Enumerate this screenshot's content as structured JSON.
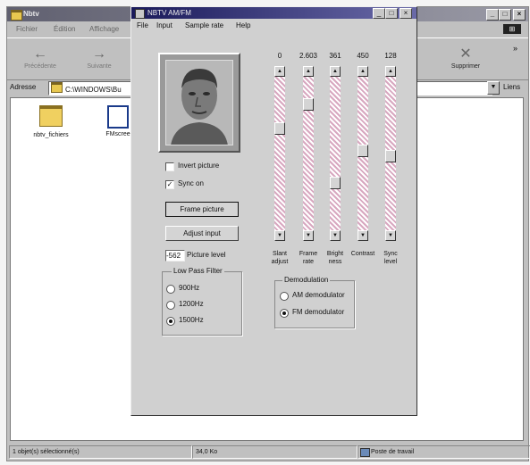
{
  "explorer": {
    "title": "Nbtv",
    "menu": [
      "Fichier",
      "Édition",
      "Affichage"
    ],
    "toolbar": {
      "back": "Précédente",
      "forward": "Suivante",
      "delete": "Supprimer"
    },
    "address_label": "Adresse",
    "address_value": "C:\\WINDOWS\\Bu",
    "links_label": "Liens",
    "files": [
      {
        "name": "nbtv_fichiers",
        "icon": "folder-icon"
      },
      {
        "name": "FMscree",
        "icon": "document-icon"
      }
    ],
    "status": {
      "selection": "1 objet(s) sélectionné(s)",
      "size": "34,0 Ko",
      "zone": "Poste de travail"
    }
  },
  "nbtv": {
    "title": "NBTV AM/FM",
    "menu": [
      "File",
      "Input",
      "Sample rate",
      "Help"
    ],
    "invert_label": "Invert picture",
    "invert_checked": false,
    "sync_label": "Sync on",
    "sync_checked": true,
    "frame_button": "Frame picture",
    "adjust_button": "Adjust input",
    "picture_level_value": "-562",
    "picture_level_label": "Picture level",
    "lowpass": {
      "title": "Low Pass Filter",
      "options": [
        "900Hz",
        "1200Hz",
        "1500Hz"
      ],
      "selected": "1500Hz"
    },
    "demod": {
      "title": "Demodulation",
      "options": [
        "AM demodulator",
        "FM demodulator"
      ],
      "selected": "FM demodulator"
    },
    "sliders": [
      {
        "value": "0",
        "label_1": "Slant",
        "label_2": "adjust",
        "level": 0.32
      },
      {
        "value": "2.603",
        "label_1": "Frame",
        "label_2": "rate",
        "level": 0.15
      },
      {
        "value": "361",
        "label_1": "Bright",
        "label_2": "ness",
        "level": 0.71
      },
      {
        "value": "450",
        "label_1": "Contrast",
        "label_2": "",
        "level": 0.48
      },
      {
        "value": "128",
        "label_1": "Sync",
        "label_2": "level",
        "level": 0.52
      }
    ]
  }
}
